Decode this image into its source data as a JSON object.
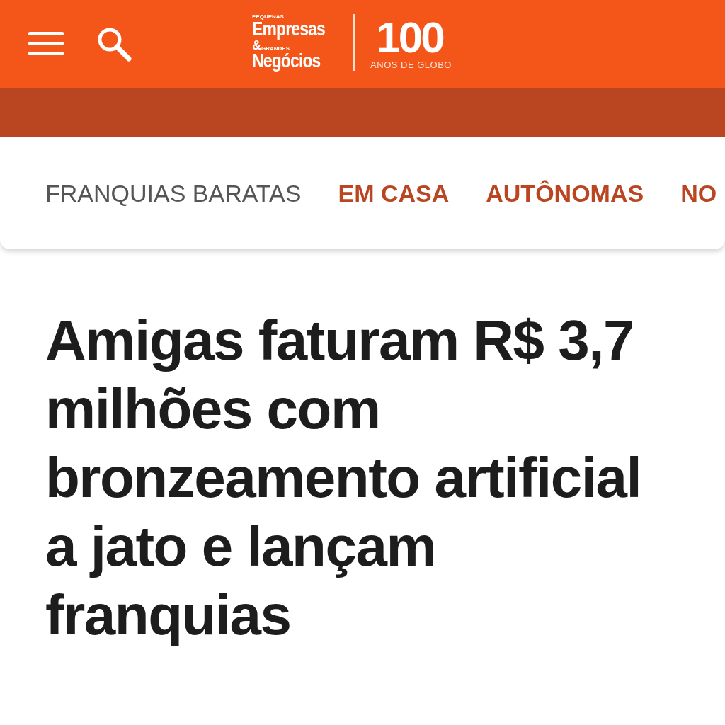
{
  "header": {
    "logo": {
      "small_top": "PEQUENAS",
      "line_1": "Empresas",
      "ampersand": "&",
      "small_bottom": "GRANDES",
      "line_2": "Negócios"
    },
    "anniversary": {
      "number": "100",
      "caption": "ANOS DE GLOBO"
    }
  },
  "nav": [
    {
      "label": "FRANQUIAS BARATAS",
      "kind": "section"
    },
    {
      "label": "EM CASA",
      "kind": "link"
    },
    {
      "label": "AUTÔNOMAS",
      "kind": "link"
    },
    {
      "label": "NO",
      "kind": "link"
    }
  ],
  "article": {
    "headline": "Amigas faturam R$ 3,7 milhões com bronzeamento artificial a jato e lançam franquias"
  }
}
